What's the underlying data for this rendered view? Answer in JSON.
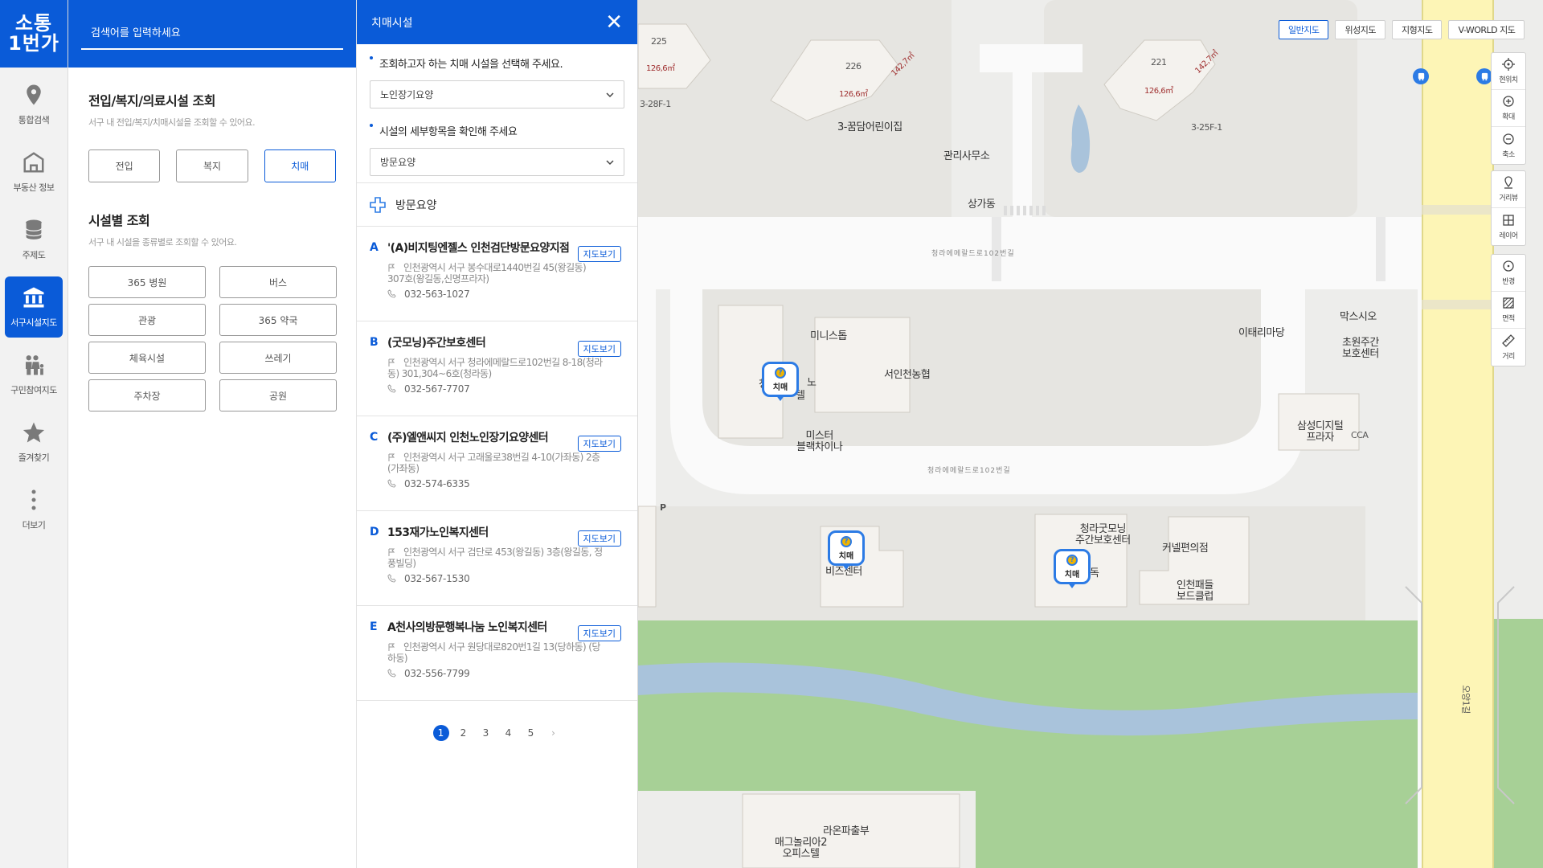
{
  "logo": {
    "line1": "소통",
    "line2": "1번가"
  },
  "rail": [
    {
      "label": "통합검색",
      "icon": "location-pin-icon",
      "active": false
    },
    {
      "label": "부동산 정보",
      "icon": "building-icon",
      "active": false
    },
    {
      "label": "주제도",
      "icon": "layers-stack-icon",
      "active": false
    },
    {
      "label": "서구시설지도",
      "icon": "public-building-icon",
      "active": true
    },
    {
      "label": "구민참여지도",
      "icon": "people-icon",
      "active": false
    },
    {
      "label": "즐겨찾기",
      "icon": "star-icon",
      "active": false
    },
    {
      "label": "더보기",
      "icon": "more-dots-icon",
      "active": false
    }
  ],
  "search": {
    "placeholder": "검색어를 입력하세요"
  },
  "section1": {
    "title": "전입/복지/의료시설 조회",
    "desc": "서구 내 전입/복지/치매시설을 조회할 수 있어요.",
    "buttons": [
      "전입",
      "복지",
      "치매"
    ],
    "active": "치매"
  },
  "section2": {
    "title": "시설별 조회",
    "desc": "서구 내 시설을 종류별로 조회할 수 있어요.",
    "buttons": [
      "365 병원",
      "버스",
      "관광",
      "365 약국",
      "체육시설",
      "쓰레기",
      "주차장",
      "공원"
    ]
  },
  "facility_panel": {
    "title": "치매시설",
    "q1": "조회하고자 하는 치매 시설을 선택해 주세요.",
    "select1": "노인장기요양",
    "q2": "시설의 세부항목을 확인해 주세요",
    "select2": "방문요양",
    "category": "방문요양",
    "map_button": "지도보기",
    "items": [
      {
        "letter": "A",
        "name": "'(A)비지팅엔젤스 인천검단방문요양지점",
        "addr": "인천광역시 서구 봉수대로1440번길 45(왕길동) 307호(왕길동,신명프라자)",
        "phone": "032-563-1027"
      },
      {
        "letter": "B",
        "name": "(굿모닝)주간보호센터",
        "addr": "인천광역시 서구 청라에메랄드로102번길 8-18(청라동) 301,304~6호(청라동)",
        "phone": "032-567-7707"
      },
      {
        "letter": "C",
        "name": "(주)엘앤씨지 인천노인장기요양센터",
        "addr": "인천광역시 서구 고래울로38번길 4-10(가좌동) 2층(가좌동)",
        "phone": "032-574-6335"
      },
      {
        "letter": "D",
        "name": "153재가노인복지센터",
        "addr": "인천광역시 서구 검단로 453(왕길동) 3층(왕길동, 정풍빌딩)",
        "phone": "032-567-1530"
      },
      {
        "letter": "E",
        "name": "A천사의방문행복나눔 노인복지센터",
        "addr": "인천광역시 서구 원당대로820번1길 13(당하동) (당하동)",
        "phone": "032-556-7799"
      }
    ],
    "pages": [
      "1",
      "2",
      "3",
      "4",
      "5",
      "›"
    ],
    "current_page": "1"
  },
  "map": {
    "map_types": [
      "일반지도",
      "위성지도",
      "지형지도",
      "V-WORLD 지도"
    ],
    "active_map_type": "일반지도",
    "tools_group1": [
      {
        "label": "현위치",
        "icon": "crosshair-icon"
      },
      {
        "label": "확대",
        "icon": "zoom-in-icon"
      },
      {
        "label": "축소",
        "icon": "zoom-out-icon"
      }
    ],
    "tools_group2": [
      {
        "label": "거리뷰",
        "icon": "street-view-icon"
      },
      {
        "label": "레이어",
        "icon": "layer-grid-icon"
      }
    ],
    "tools_group3": [
      {
        "label": "반경",
        "icon": "radius-icon"
      },
      {
        "label": "면적",
        "icon": "area-icon"
      },
      {
        "label": "거리",
        "icon": "ruler-icon"
      }
    ],
    "marker_label": "치매",
    "labels": {
      "b225": "225",
      "b226": "226",
      "b221": "221",
      "a1": "126,6㎡",
      "a2": "126,6㎡",
      "a3": "126,6㎡",
      "a4": "142,7㎡",
      "a5": "142,7㎡",
      "l_328f": "3-28F-1",
      "l_325f": "3-25F-1",
      "kumdam": "3-꿈담어린이집",
      "office": "관리사무소",
      "shops": "상가동",
      "road1": "청라에메랄드로102번길",
      "road2": "청라에메랄드로102번길",
      "ministop": "미니스톱",
      "seoin": "서인천농협",
      "mister": "미스터\n블랙차이나",
      "italy": "이태리마당",
      "maxsio": "막스시오",
      "chowon": "초원주간\n보호센터",
      "samsung": "삼성디지털\n프라자",
      "cca": "CCA",
      "bizcenter": "비즈센터",
      "goodmorning": "청라굿모닝\n주간보호센터",
      "convenience": "커넬편의점",
      "boardclub": "인천패들\n보드클럽",
      "magnolia": "매그놀리아2\n오피스텔",
      "raon": "라온파출부",
      "p": "P",
      "side_road": "오양1길",
      "partial1": "청",
      "partial2": "노",
      "partial3": "텔",
      "partial4": "독"
    }
  }
}
